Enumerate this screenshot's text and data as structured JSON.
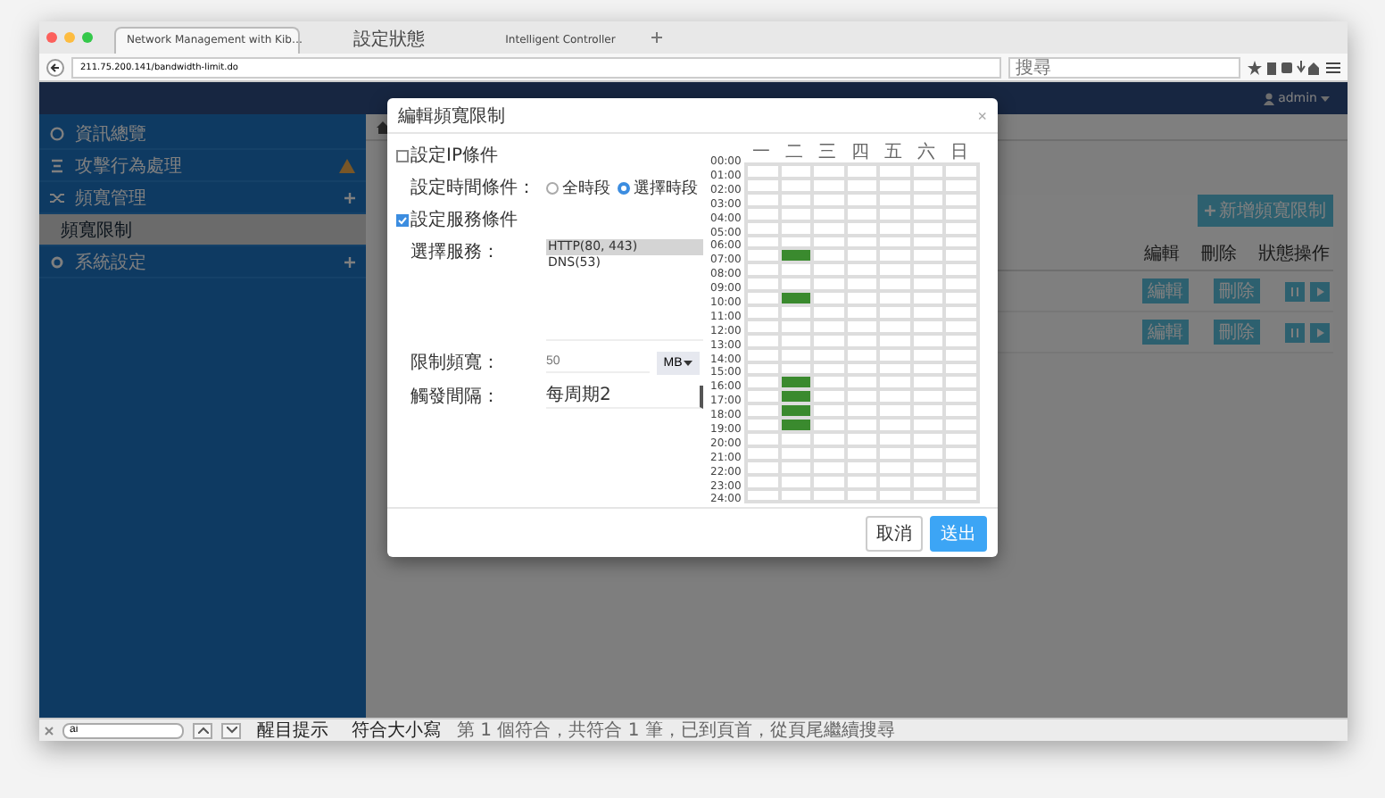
{
  "browser": {
    "tabs": [
      {
        "title": "Network Management with Kib…",
        "selected": true
      },
      {
        "title": "設定狀態",
        "selected": false
      },
      {
        "title": "Intelligent Controller",
        "selected": false
      }
    ],
    "url": "211.75.200.141/bandwidth-limit.do",
    "search": {
      "placeholder": "搜尋"
    }
  },
  "navbar": {
    "user": "admin"
  },
  "sidebar": {
    "items": [
      {
        "label": "資訊總覽",
        "selected": false,
        "warning": false,
        "expandable": false
      },
      {
        "label": "攻擊行為處理",
        "selected": false,
        "warning": true,
        "expandable": false
      },
      {
        "label": "頻寬管理",
        "selected": false,
        "warning": false,
        "expandable": true
      },
      {
        "label": "頻寬限制",
        "selected": true,
        "warning": false,
        "expandable": false
      },
      {
        "label": "系統設定",
        "selected": false,
        "warning": false,
        "expandable": true
      }
    ]
  },
  "page": {
    "add_button": "新增頻寬限制",
    "table": {
      "columns": [
        "編輯",
        "刪除",
        "狀態操作"
      ],
      "rows": [
        {
          "edit": "編輯",
          "delete": "刪除"
        },
        {
          "edit": "編輯",
          "delete": "刪除"
        }
      ]
    }
  },
  "modal": {
    "title": "編輯頻寬限制",
    "close": "×",
    "ip_condition": {
      "label": "設定IP條件",
      "checked": false
    },
    "time_condition": {
      "label": "設定時間條件：",
      "options": [
        {
          "label": "全時段",
          "selected": false
        },
        {
          "label": "選擇時段",
          "selected": true
        }
      ]
    },
    "service_condition": {
      "label": "設定服務條件",
      "checked": true
    },
    "service": {
      "label": "選擇服務：",
      "options": [
        {
          "label": "HTTP(80, 443)",
          "selected": true
        },
        {
          "label": "DNS(53)",
          "selected": false
        }
      ]
    },
    "bandwidth": {
      "label": "限制頻寬：",
      "placeholder": "50",
      "unit": "MB"
    },
    "interval": {
      "label": "觸發間隔：",
      "value": "每周期2"
    },
    "schedule": {
      "days": [
        "一",
        "二",
        "三",
        "四",
        "五",
        "六",
        "日"
      ],
      "times": [
        "00:00",
        "01:00",
        "02:00",
        "03:00",
        "04:00",
        "05:00",
        "06:00",
        "07:00",
        "08:00",
        "09:00",
        "10:00",
        "11:00",
        "12:00",
        "13:00",
        "14:00",
        "15:00",
        "16:00",
        "17:00",
        "18:00",
        "19:00",
        "20:00",
        "21:00",
        "22:00",
        "23:00",
        "24:00"
      ],
      "rows": [
        {
          "cells": [
            false,
            false,
            false,
            false,
            false,
            false,
            false
          ]
        },
        {
          "cells": [
            false,
            false,
            false,
            false,
            false,
            false,
            false
          ]
        },
        {
          "cells": [
            false,
            false,
            false,
            false,
            false,
            false,
            false
          ]
        },
        {
          "cells": [
            false,
            false,
            false,
            false,
            false,
            false,
            false
          ]
        },
        {
          "cells": [
            false,
            false,
            false,
            false,
            false,
            false,
            false
          ]
        },
        {
          "cells": [
            false,
            false,
            false,
            false,
            false,
            false,
            false
          ]
        },
        {
          "cells": [
            false,
            true,
            false,
            false,
            false,
            false,
            false
          ]
        },
        {
          "cells": [
            false,
            false,
            false,
            false,
            false,
            false,
            false
          ]
        },
        {
          "cells": [
            false,
            false,
            false,
            false,
            false,
            false,
            false
          ]
        },
        {
          "cells": [
            false,
            true,
            false,
            false,
            false,
            false,
            false
          ]
        },
        {
          "cells": [
            false,
            false,
            false,
            false,
            false,
            false,
            false
          ]
        },
        {
          "cells": [
            false,
            false,
            false,
            false,
            false,
            false,
            false
          ]
        },
        {
          "cells": [
            false,
            false,
            false,
            false,
            false,
            false,
            false
          ]
        },
        {
          "cells": [
            false,
            false,
            false,
            false,
            false,
            false,
            false
          ]
        },
        {
          "cells": [
            false,
            false,
            false,
            false,
            false,
            false,
            false
          ]
        },
        {
          "cells": [
            false,
            true,
            false,
            false,
            false,
            false,
            false
          ]
        },
        {
          "cells": [
            false,
            true,
            false,
            false,
            false,
            false,
            false
          ]
        },
        {
          "cells": [
            false,
            true,
            false,
            false,
            false,
            false,
            false
          ]
        },
        {
          "cells": [
            false,
            true,
            false,
            false,
            false,
            false,
            false
          ]
        },
        {
          "cells": [
            false,
            false,
            false,
            false,
            false,
            false,
            false
          ]
        },
        {
          "cells": [
            false,
            false,
            false,
            false,
            false,
            false,
            false
          ]
        },
        {
          "cells": [
            false,
            false,
            false,
            false,
            false,
            false,
            false
          ]
        },
        {
          "cells": [
            false,
            false,
            false,
            false,
            false,
            false,
            false
          ]
        },
        {
          "cells": [
            false,
            false,
            false,
            false,
            false,
            false,
            false
          ]
        }
      ]
    },
    "buttons": [
      {
        "label": "取消",
        "kind": "secondary"
      },
      {
        "label": "送出",
        "kind": "primary"
      }
    ]
  },
  "find_bar": {
    "value": "ai",
    "highlight": "醒目提示",
    "match_case": "符合大小寫",
    "status": "第 1 個符合，共符合 1 筆，已到頁首，從頁尾繼續搜尋"
  }
}
